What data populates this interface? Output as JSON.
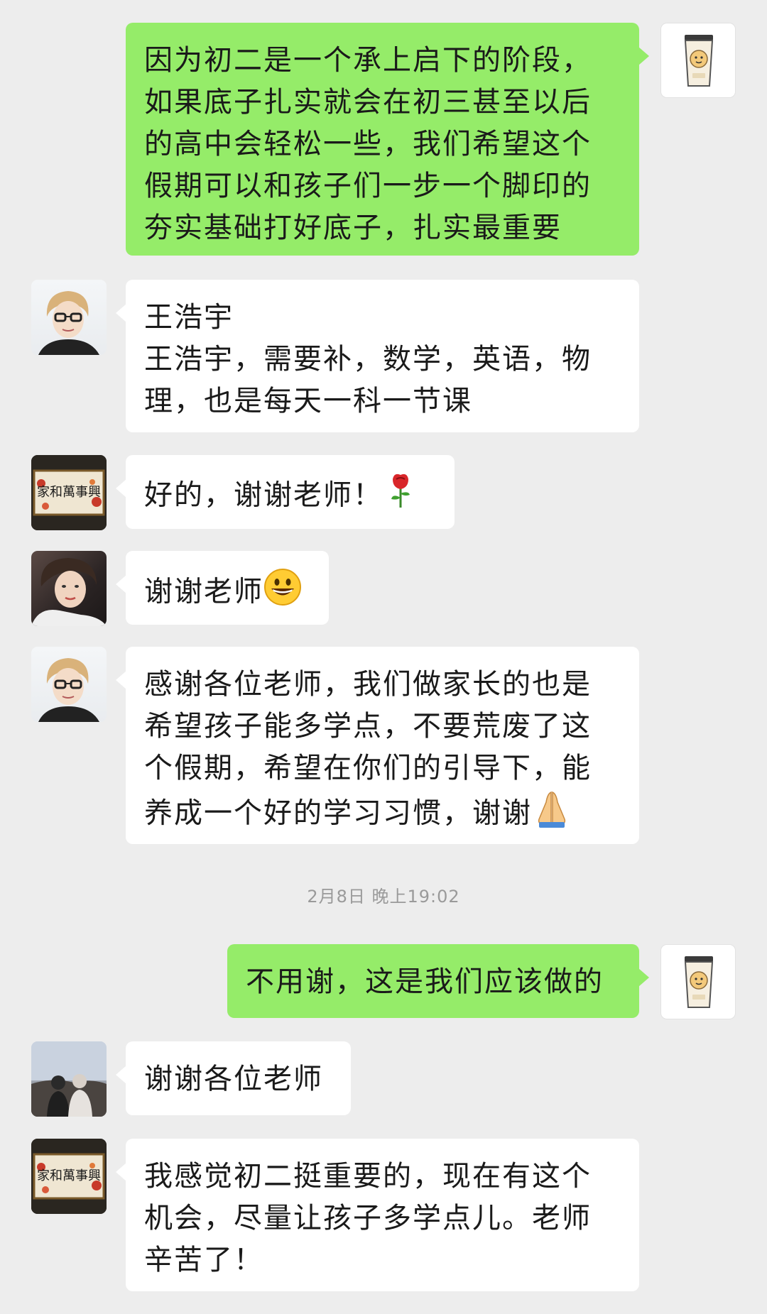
{
  "messages": [
    {
      "sender": "me",
      "avatar": "milk-tea-cup-avatar",
      "lines": [
        "因为初二是一个承上启下的阶段，",
        "如果底子扎实就会在初三甚至以后",
        "的高中会轻松一些，我们希望这个",
        "假期可以和孩子们一步一个脚印的",
        "夯实基础打好底子，扎实最重要"
      ]
    },
    {
      "sender": "other",
      "avatar": "woman-glasses-avatar",
      "lines": [
        "王浩宇",
        "王浩宇，需要补，数学，英语，物",
        "理，也是每天一科一节课"
      ]
    },
    {
      "sender": "other",
      "avatar": "family-banner-avatar",
      "lines": [
        "好的，谢谢老师！"
      ],
      "emoji": "rose-emoji"
    },
    {
      "sender": "other",
      "avatar": "woman-portrait-avatar",
      "lines": [
        "谢谢老师"
      ],
      "emoji": "grinning-face-emoji"
    },
    {
      "sender": "other",
      "avatar": "woman-glasses-avatar",
      "lines": [
        "感谢各位老师，我们做家长的也是",
        "希望孩子能多学点，不要荒废了这",
        "个假期，希望在你们的引导下，能",
        "养成一个好的学习习惯，谢谢"
      ],
      "emoji": "folded-hands-emoji"
    },
    {
      "sender": "me",
      "avatar": "milk-tea-cup-avatar",
      "lines": [
        "不用谢，这是我们应该做的"
      ]
    },
    {
      "sender": "other",
      "avatar": "outdoor-photo-avatar",
      "lines": [
        "谢谢各位老师"
      ]
    },
    {
      "sender": "other",
      "avatar": "family-banner-avatar",
      "lines": [
        "我感觉初二挺重要的，现在有这个",
        "机会，尽量让孩子多学点儿。老师",
        "辛苦了！"
      ]
    }
  ],
  "timestamp": "2月8日 晚上19:02",
  "banner_text": "家和萬事興",
  "colors": {
    "background": "#ededed",
    "my_bubble": "#95ec69",
    "other_bubble": "#ffffff",
    "timestamp": "#9a9a9a"
  }
}
